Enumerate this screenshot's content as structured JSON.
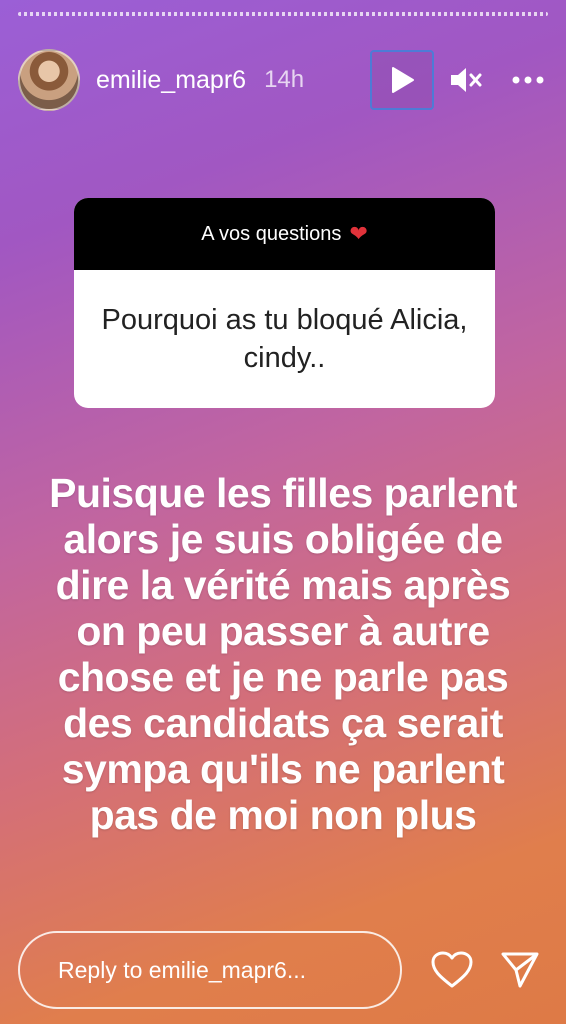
{
  "header": {
    "username": "emilie_mapr6",
    "time": "14h"
  },
  "icons": {
    "play": "play-icon",
    "mute": "mute-icon",
    "more": "more-icon",
    "question_heart": "heart-emoji-icon",
    "like": "heart-outline-icon",
    "send": "send-icon"
  },
  "question_card": {
    "title": "A vos questions",
    "heart": "❤",
    "question": "Pourquoi as tu bloqué Alicia, cindy.."
  },
  "story": {
    "text": "Puisque les filles parlent alors je suis obligée de dire la vérité mais après on peu passer à autre chose et je ne parle pas des candidats ça serait sympa qu'ils ne parlent pas de moi non plus"
  },
  "footer": {
    "reply_placeholder": "Reply to emilie_mapr6..."
  },
  "colors": {
    "accent_focus": "#4e7bd6",
    "heart_red": "#e0323a"
  }
}
